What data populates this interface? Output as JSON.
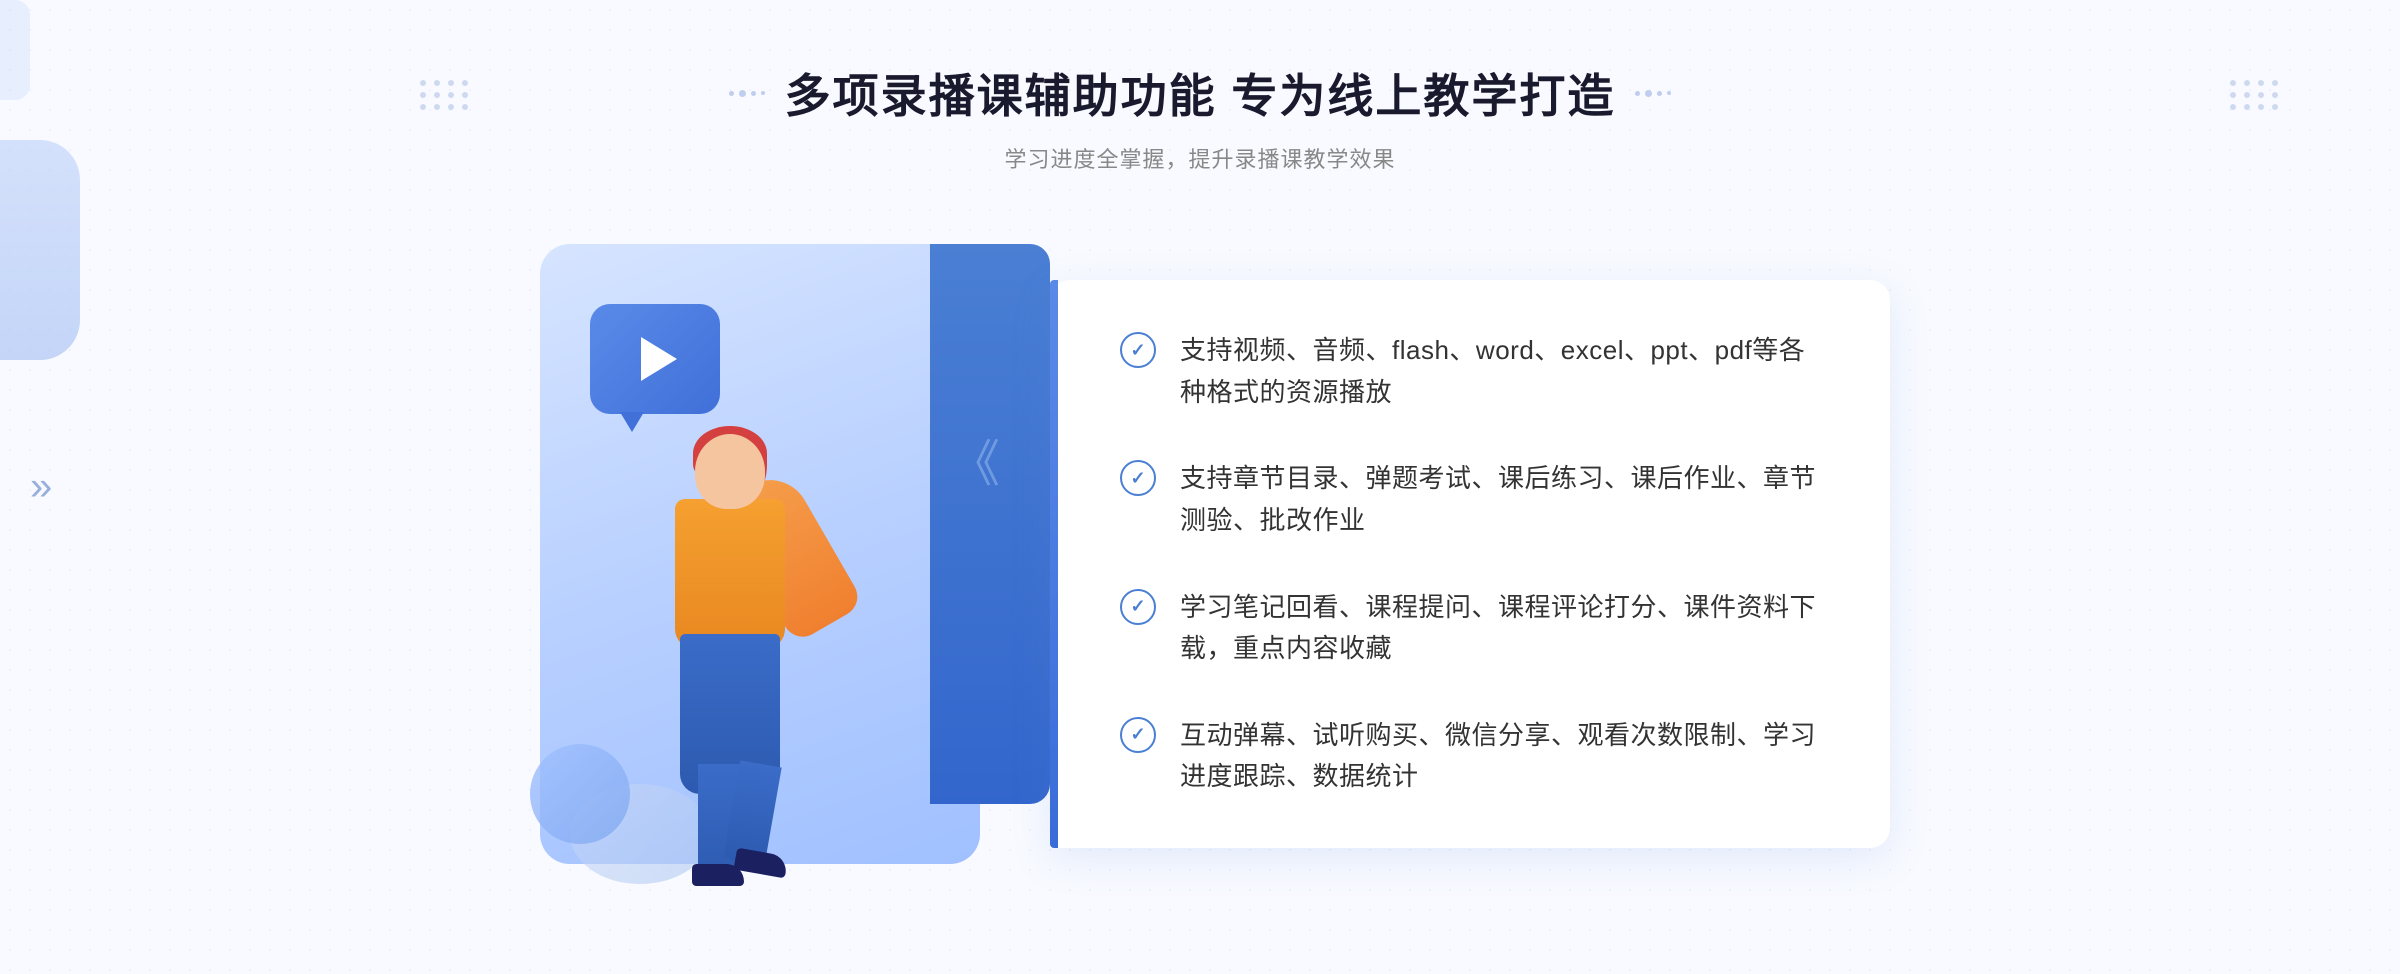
{
  "header": {
    "main_title": "多项录播课辅助功能 专为线上教学打造",
    "sub_title": "学习进度全掌握，提升录播课教学效果"
  },
  "features": [
    {
      "id": 1,
      "text": "支持视频、音频、flash、word、excel、ppt、pdf等各种格式的资源播放"
    },
    {
      "id": 2,
      "text": "支持章节目录、弹题考试、课后练习、课后作业、章节测验、批改作业"
    },
    {
      "id": 3,
      "text": "学习笔记回看、课程提问、课程评论打分、课件资料下载，重点内容收藏"
    },
    {
      "id": 4,
      "text": "互动弹幕、试听购买、微信分享、观看次数限制、学习进度跟踪、数据统计"
    }
  ],
  "decorations": {
    "left_arrow": "»",
    "play_button_label": "play"
  }
}
